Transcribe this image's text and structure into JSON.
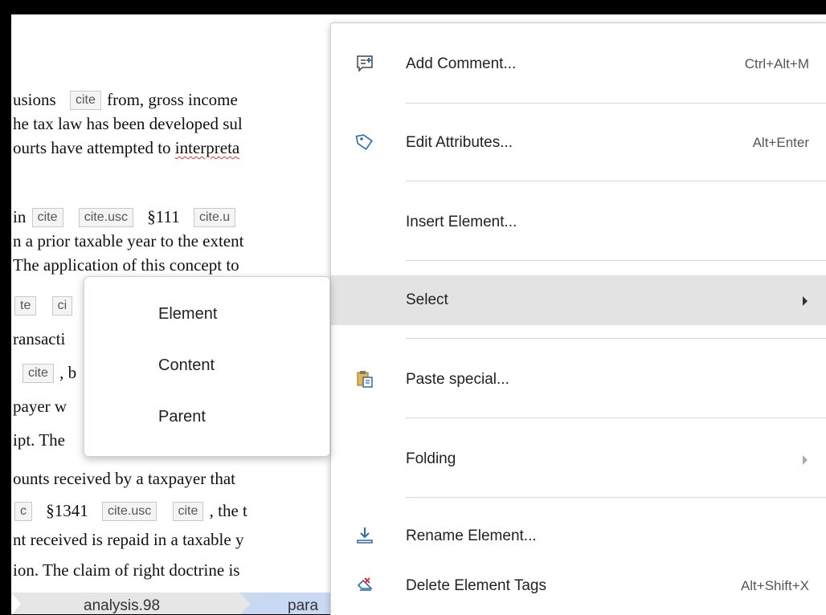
{
  "document": {
    "lines": [
      {
        "pre": "usions",
        "tag1": "cite",
        "post": "from, gross income"
      },
      {
        "text": "he tax law has been developed sul"
      },
      {
        "pre": "ourts have attempted to ",
        "squiggle": "interpreta"
      },
      {
        "pre": "in",
        "tag1": "cite",
        "tag2": "cite.usc",
        "mid": "§111",
        "tag3": "cite.u"
      },
      {
        "text": "n a prior taxable year to the extent"
      },
      {
        "text": "The application of this concept to"
      },
      {
        "tag1": "te",
        "tag2": "ci"
      },
      {
        "text": "ransacti"
      },
      {
        "tag1": "cite",
        "post": ", b"
      },
      {
        "text": "payer w"
      },
      {
        "text": "ipt. The"
      },
      {
        "text": "ounts received by a taxpayer that"
      },
      {
        "tag1": "c",
        "mid": "§1341",
        "tag2": "cite.usc",
        "tag3": "cite",
        "post": ", the t"
      },
      {
        "text": "nt received is repaid in a taxable y"
      },
      {
        "text": "ion. The claim of right doctrine is"
      }
    ]
  },
  "breadcrumb": {
    "items": [
      "analysis.98",
      "para"
    ]
  },
  "context_menu": {
    "items": [
      {
        "label": "Add Comment...",
        "shortcut": "Ctrl+Alt+M",
        "icon": "add-comment-icon"
      },
      {
        "label": "Edit Attributes...",
        "shortcut": "Alt+Enter",
        "icon": "tag-icon"
      },
      {
        "label": "Insert Element...",
        "shortcut": ""
      },
      {
        "label": "Select",
        "shortcut": "",
        "submenu": true,
        "highlighted": true
      },
      {
        "label": "Paste special...",
        "shortcut": "",
        "icon": "paste-special-icon"
      },
      {
        "label": "Folding",
        "shortcut": "",
        "submenu": true,
        "disabled_arrow": true
      },
      {
        "label": "Rename Element...",
        "shortcut": "",
        "icon": "rename-element-icon"
      },
      {
        "label": "Delete Element Tags",
        "shortcut": "Alt+Shift+X",
        "icon": "delete-tags-icon"
      }
    ]
  },
  "submenu": {
    "items": [
      "Element",
      "Content",
      "Parent"
    ]
  },
  "colors": {
    "highlight": "#e3e3e3",
    "breadcrumb_active": "#c8d9f1",
    "icon_blue": "#2b6cb0",
    "icon_red": "#d33"
  }
}
